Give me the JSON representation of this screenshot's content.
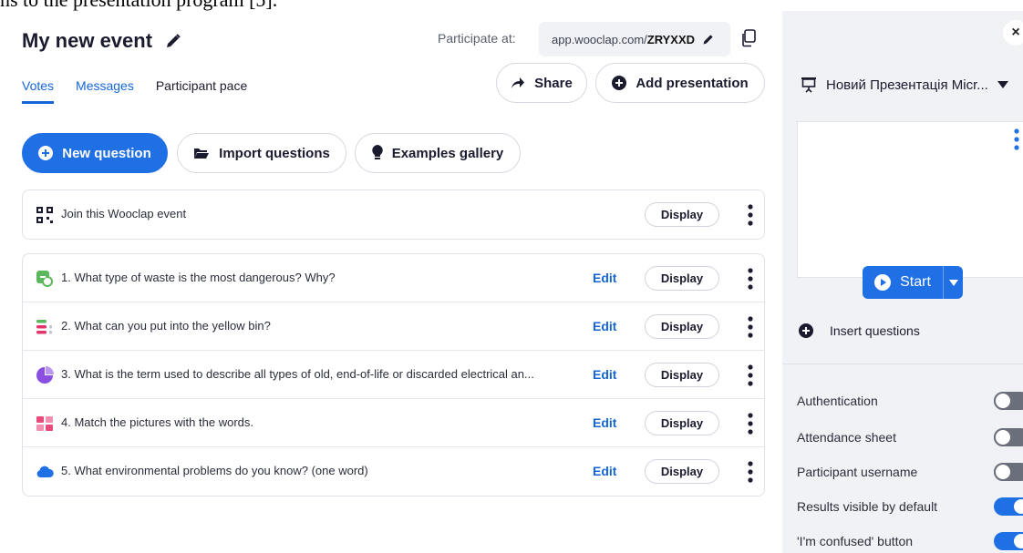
{
  "document_text": "ns to the presentation program [5].",
  "event": {
    "title": "My new event",
    "participate_label": "Participate at:",
    "url_prefix": "app.wooclap.com/",
    "url_code": "ZRYXXD"
  },
  "tabs": [
    {
      "label": "Votes",
      "active": true
    },
    {
      "label": "Messages",
      "active": false
    },
    {
      "label": "Participant pace",
      "active": false
    }
  ],
  "actions": {
    "share": "Share",
    "add_presentation": "Add presentation",
    "new_question": "New question",
    "import_questions": "Import questions",
    "examples_gallery": "Examples gallery"
  },
  "join_row": {
    "text": "Join this Wooclap event",
    "display": "Display"
  },
  "questions": [
    {
      "text": "1. What type of waste is the most dangerous? Why?",
      "edit": "Edit",
      "display": "Display",
      "icon": "open-question-icon",
      "color": "#5cb85c"
    },
    {
      "text": "2. What can you put into the yellow bin?",
      "edit": "Edit",
      "display": "Display",
      "icon": "sorting-icon",
      "color": "#e3356b"
    },
    {
      "text": "3. What is the term used to describe all types of old, end-of-life or discarded electrical an...",
      "edit": "Edit",
      "display": "Display",
      "icon": "pie-icon",
      "color": "#8a4fe0"
    },
    {
      "text": "4. Match the pictures with the words.",
      "edit": "Edit",
      "display": "Display",
      "icon": "matching-icon",
      "color": "#e84b7a"
    },
    {
      "text": "5. What environmental problems do you know? (one word)",
      "edit": "Edit",
      "display": "Display",
      "icon": "cloud-icon",
      "color": "#1f6fe5"
    }
  ],
  "sidebar": {
    "close": "×",
    "presentation_name": "Новий Презентація Micr...",
    "start": "Start",
    "insert_questions": "Insert questions",
    "settings": [
      {
        "label": "Authentication",
        "on": false
      },
      {
        "label": "Attendance sheet",
        "on": false
      },
      {
        "label": "Participant username",
        "on": false
      },
      {
        "label": "Results visible by default",
        "on": true
      },
      {
        "label": "'I'm confused' button",
        "on": true
      }
    ]
  },
  "colors": {
    "primary": "#1f6fe5",
    "link": "#1565d8",
    "panel_bg": "#f1f2f5"
  }
}
